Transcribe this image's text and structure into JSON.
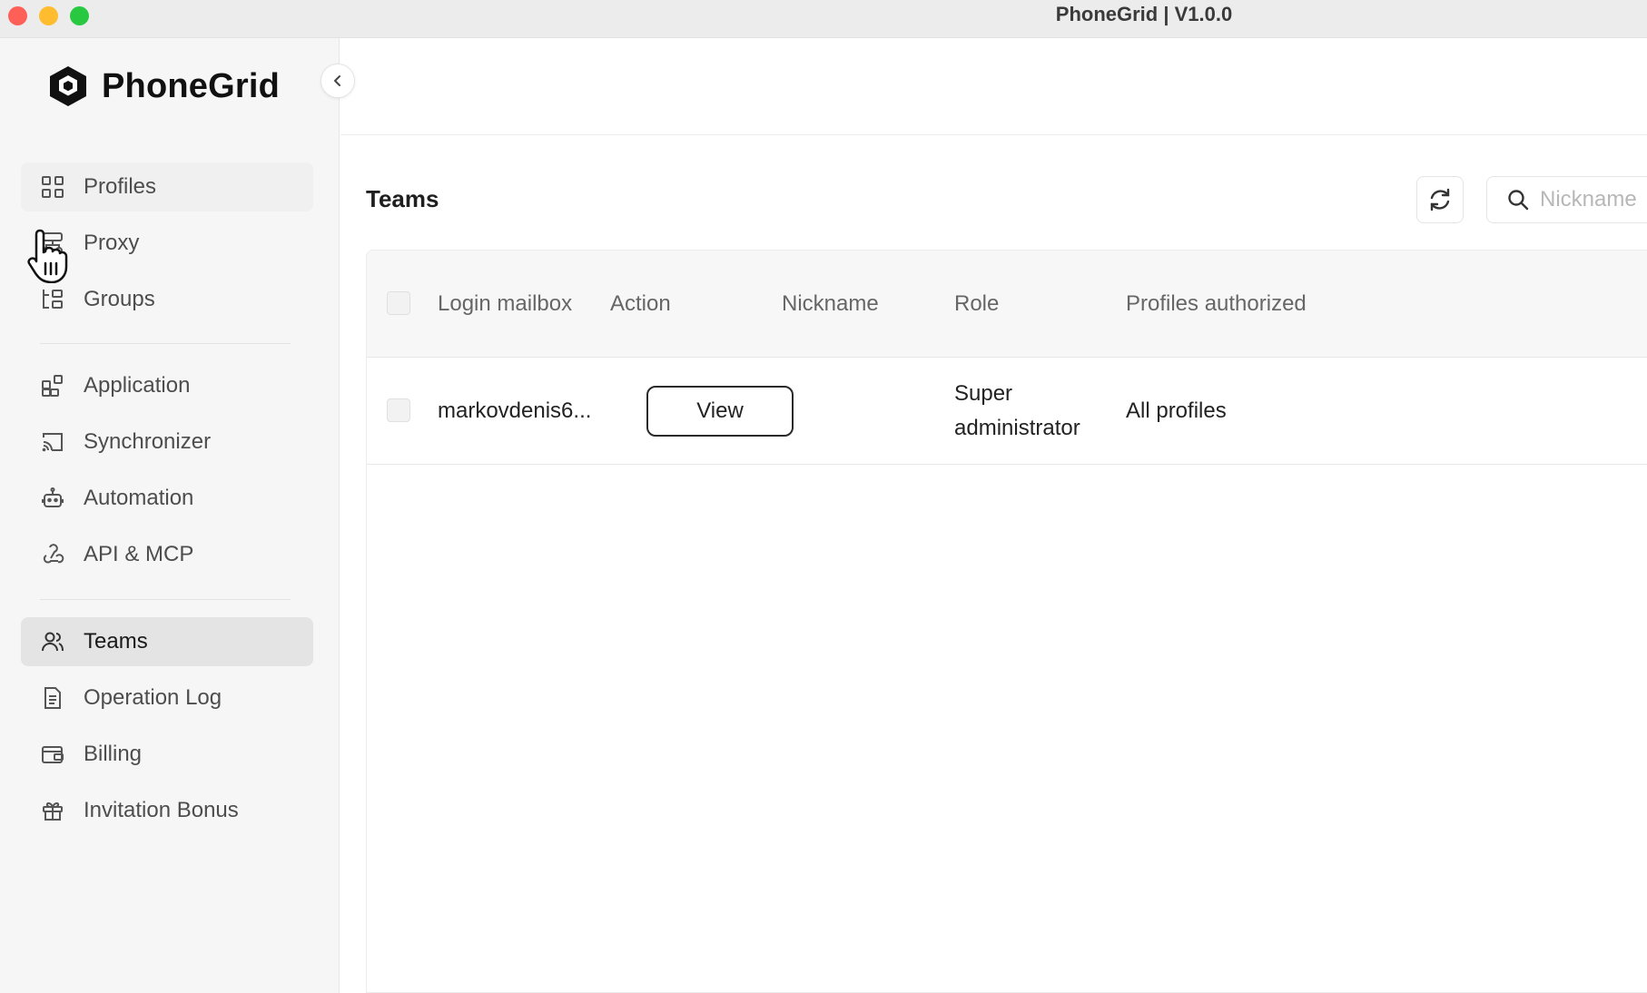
{
  "window": {
    "title": "PhoneGrid | V1.0.0"
  },
  "brand": {
    "name": "PhoneGrid"
  },
  "sidebar": {
    "items": [
      {
        "label": "Profiles",
        "icon": "grid-icon"
      },
      {
        "label": "Proxy",
        "icon": "proxy-icon"
      },
      {
        "label": "Groups",
        "icon": "groups-icon"
      },
      {
        "label": "Application",
        "icon": "application-icon"
      },
      {
        "label": "Synchronizer",
        "icon": "cast-icon"
      },
      {
        "label": "Automation",
        "icon": "robot-icon"
      },
      {
        "label": "API & MCP",
        "icon": "webhook-icon"
      },
      {
        "label": "Teams",
        "icon": "users-icon",
        "active": true
      },
      {
        "label": "Operation Log",
        "icon": "document-icon"
      },
      {
        "label": "Billing",
        "icon": "wallet-icon"
      },
      {
        "label": "Invitation Bonus",
        "icon": "gift-icon"
      }
    ]
  },
  "main": {
    "title": "Teams",
    "search": {
      "placeholder": "Nickname",
      "value": ""
    },
    "table": {
      "headers": [
        "Login mailbox",
        "Action",
        "Nickname",
        "Role",
        "Profiles authorized"
      ],
      "rows": [
        {
          "login": "markovdenis6...",
          "action": "View",
          "nickname": "",
          "role": "Super administrator",
          "profiles": "All profiles"
        }
      ]
    }
  },
  "colors": {
    "active_bg": "#e4e4e4",
    "sidebar_bg": "#f6f6f6",
    "close": "#fe5f57",
    "minimize": "#febc2e",
    "maximize": "#28c840"
  }
}
